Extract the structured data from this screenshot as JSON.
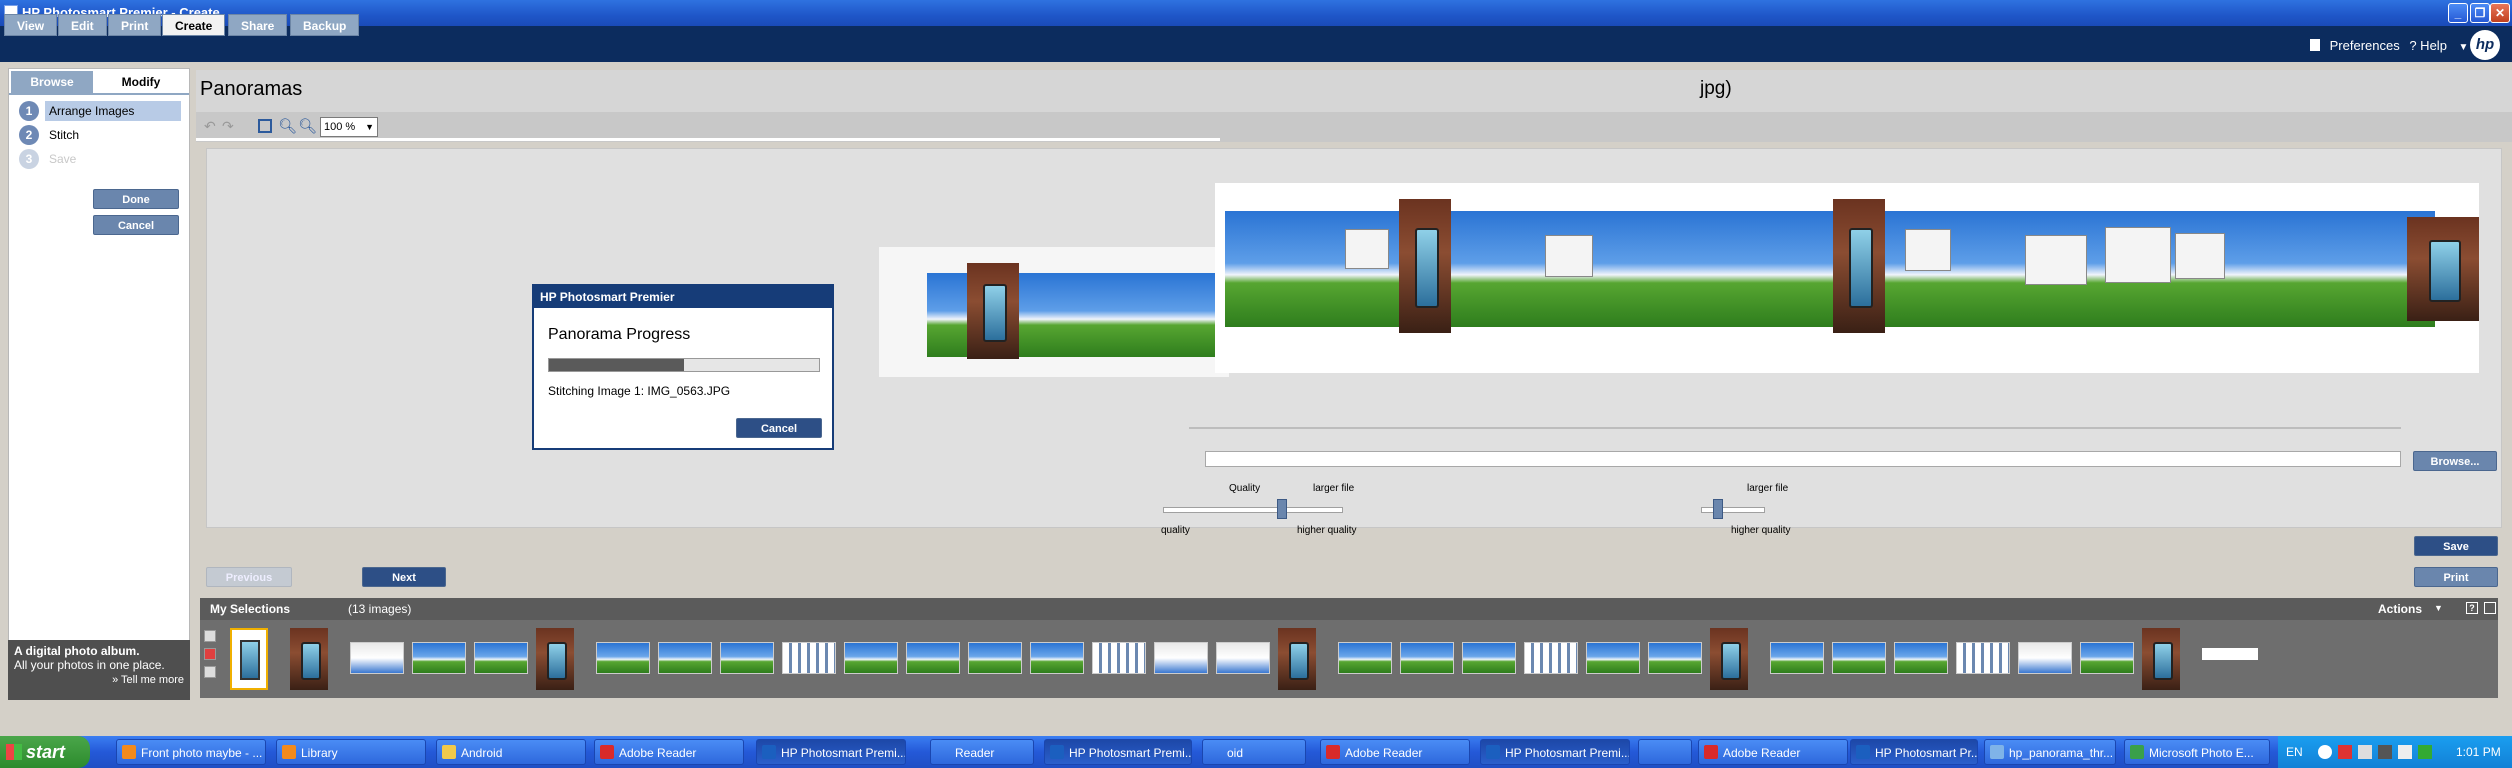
{
  "window": {
    "title": "HP Photosmart Premier - Create"
  },
  "nav": {
    "tabs": [
      {
        "label": "View"
      },
      {
        "label": "Edit"
      },
      {
        "label": "Print"
      },
      {
        "label": "Create"
      },
      {
        "label": "Share"
      },
      {
        "label": "Backup"
      }
    ],
    "active_tab": "Create",
    "preferences": "Preferences",
    "help": "? Help",
    "logo": "hp"
  },
  "sidebar": {
    "tabs": [
      {
        "label": "Browse"
      },
      {
        "label": "Modify"
      }
    ],
    "steps": [
      {
        "num": "1",
        "label": "Arrange Images"
      },
      {
        "num": "2",
        "label": "Stitch"
      },
      {
        "num": "3",
        "label": "Save"
      }
    ],
    "done_label": "Done",
    "cancel_label": "Cancel",
    "promo": {
      "title": "A digital photo album.",
      "text": "All your photos in one place.",
      "link": "» Tell me more"
    }
  },
  "main": {
    "title": "Panoramas",
    "title_right": "jpg)",
    "zoom": "100 %",
    "browse_label": "Browse...",
    "slider_left": {
      "top_label": "Quality",
      "right_top": "larger file",
      "left_bottom": "quality",
      "right_bottom": "higher quality"
    },
    "slider_right": {
      "right_top": "larger file",
      "right_bottom": "higher quality"
    },
    "save_label": "Save",
    "print_label": "Print",
    "previous_label": "Previous",
    "next_label": "Next"
  },
  "dialog": {
    "title": "HP Photosmart Premier",
    "heading": "Panorama Progress",
    "status": "Stitching Image  1: IMG_0563.JPG",
    "progress": 0.5,
    "cancel_label": "Cancel"
  },
  "selections": {
    "label": "My Selections",
    "count": "(13 images)",
    "actions_label": "Actions"
  },
  "taskbar": {
    "start_label": "start",
    "items": [
      {
        "label": "Front photo maybe - ...",
        "icon": "firefox-icon"
      },
      {
        "label": "Library",
        "icon": "firefox-icon"
      },
      {
        "label": "Android",
        "icon": "folder-icon"
      },
      {
        "label": "Adobe Reader",
        "icon": "pdf-icon"
      },
      {
        "label": "HP Photosmart Premi...",
        "icon": "hp-icon"
      },
      {
        "label": "Reader",
        "icon": ""
      },
      {
        "label": "HP Photosmart Premi...",
        "icon": "hp-icon"
      },
      {
        "label": "oid",
        "icon": ""
      },
      {
        "label": "Adobe Reader",
        "icon": "pdf-icon"
      },
      {
        "label": "HP Photosmart Premi...",
        "icon": "hp-icon"
      },
      {
        "label": "",
        "icon": ""
      },
      {
        "label": "Adobe Reader",
        "icon": "pdf-icon"
      },
      {
        "label": "HP Photosmart Pr...",
        "icon": "hp-icon"
      },
      {
        "label": "hp_panorama_thr...",
        "icon": "image-icon"
      },
      {
        "label": "Microsoft Photo E...",
        "icon": "photo-icon"
      }
    ],
    "lang": "EN",
    "clock": "1:01 PM"
  },
  "colors": {
    "nav_bg": "#0c2c5e",
    "accent": "#163c78",
    "button": "#6a86ad",
    "taskbar": "#2459d8",
    "start": "#3a9a3a"
  }
}
